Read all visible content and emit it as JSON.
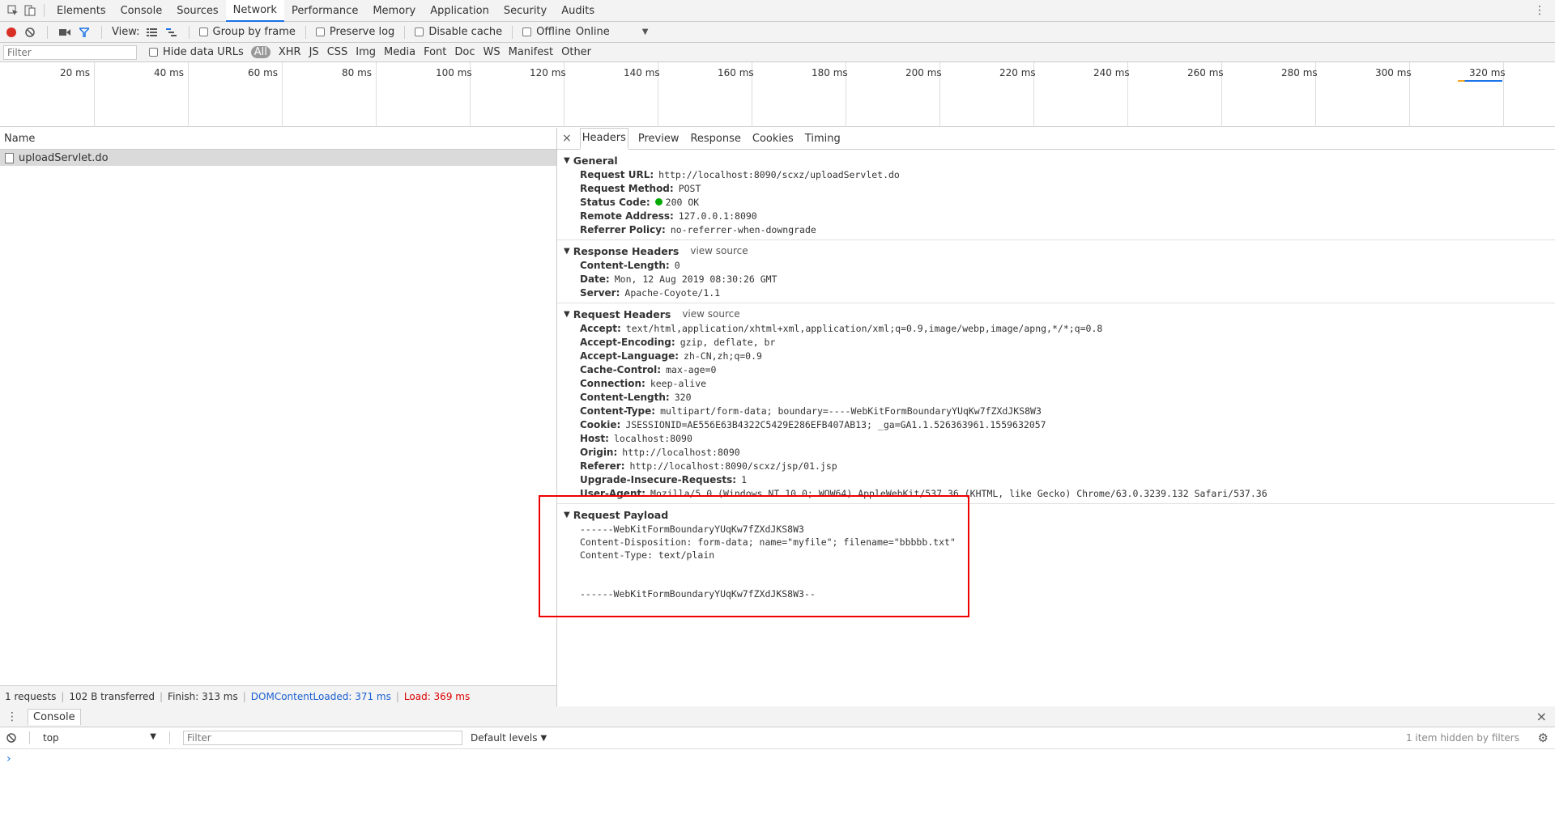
{
  "topbar": {
    "tabs": [
      "Elements",
      "Console",
      "Sources",
      "Network",
      "Performance",
      "Memory",
      "Application",
      "Security",
      "Audits"
    ],
    "active": "Network"
  },
  "toolbar": {
    "view_label": "View:",
    "group_by_frame": "Group by frame",
    "preserve_log": "Preserve log",
    "disable_cache": "Disable cache",
    "offline": "Offline",
    "throttle": "Online"
  },
  "filterbar": {
    "placeholder": "Filter",
    "hide_data_urls": "Hide data URLs",
    "types": [
      "All",
      "XHR",
      "JS",
      "CSS",
      "Img",
      "Media",
      "Font",
      "Doc",
      "WS",
      "Manifest",
      "Other"
    ]
  },
  "timeline": {
    "ticks": [
      "20 ms",
      "40 ms",
      "60 ms",
      "80 ms",
      "100 ms",
      "120 ms",
      "140 ms",
      "160 ms",
      "180 ms",
      "200 ms",
      "220 ms",
      "240 ms",
      "260 ms",
      "280 ms",
      "300 ms",
      "320 ms"
    ]
  },
  "requests": {
    "name_header": "Name",
    "items": [
      "uploadServlet.do"
    ]
  },
  "status": {
    "requests": "1 requests",
    "transferred": "102 B transferred",
    "finish": "Finish: 313 ms",
    "dcl": "DOMContentLoaded: 371 ms",
    "load": "Load: 369 ms"
  },
  "detail": {
    "tabs": [
      "Headers",
      "Preview",
      "Response",
      "Cookies",
      "Timing"
    ],
    "general": {
      "title": "General",
      "rows": [
        {
          "k": "Request URL:",
          "v": "http://localhost:8090/scxz/uploadServlet.do"
        },
        {
          "k": "Request Method:",
          "v": "POST"
        },
        {
          "k": "Status Code:",
          "v": "200 OK"
        },
        {
          "k": "Remote Address:",
          "v": "127.0.0.1:8090"
        },
        {
          "k": "Referrer Policy:",
          "v": "no-referrer-when-downgrade"
        }
      ]
    },
    "response_headers": {
      "title": "Response Headers",
      "view_source": "view source",
      "rows": [
        {
          "k": "Content-Length:",
          "v": "0"
        },
        {
          "k": "Date:",
          "v": "Mon, 12 Aug 2019 08:30:26 GMT"
        },
        {
          "k": "Server:",
          "v": "Apache-Coyote/1.1"
        }
      ]
    },
    "request_headers": {
      "title": "Request Headers",
      "view_source": "view source",
      "rows": [
        {
          "k": "Accept:",
          "v": "text/html,application/xhtml+xml,application/xml;q=0.9,image/webp,image/apng,*/*;q=0.8"
        },
        {
          "k": "Accept-Encoding:",
          "v": "gzip, deflate, br"
        },
        {
          "k": "Accept-Language:",
          "v": "zh-CN,zh;q=0.9"
        },
        {
          "k": "Cache-Control:",
          "v": "max-age=0"
        },
        {
          "k": "Connection:",
          "v": "keep-alive"
        },
        {
          "k": "Content-Length:",
          "v": "320"
        },
        {
          "k": "Content-Type:",
          "v": "multipart/form-data; boundary=----WebKitFormBoundaryYUqKw7fZXdJKS8W3"
        },
        {
          "k": "Cookie:",
          "v": "JSESSIONID=AE556E63B4322C5429E286EFB407AB13; _ga=GA1.1.526363961.1559632057"
        },
        {
          "k": "Host:",
          "v": "localhost:8090"
        },
        {
          "k": "Origin:",
          "v": "http://localhost:8090"
        },
        {
          "k": "Referer:",
          "v": "http://localhost:8090/scxz/jsp/01.jsp"
        },
        {
          "k": "Upgrade-Insecure-Requests:",
          "v": "1"
        },
        {
          "k": "User-Agent:",
          "v": "Mozilla/5.0 (Windows NT 10.0; WOW64) AppleWebKit/537.36 (KHTML, like Gecko) Chrome/63.0.3239.132 Safari/537.36"
        }
      ]
    },
    "payload": {
      "title": "Request Payload",
      "lines": [
        "------WebKitFormBoundaryYUqKw7fZXdJKS8W3",
        "Content-Disposition: form-data; name=\"myfile\"; filename=\"bbbbb.txt\"",
        "Content-Type: text/plain",
        "",
        "",
        "------WebKitFormBoundaryYUqKw7fZXdJKS8W3--"
      ]
    }
  },
  "drawer": {
    "tab": "Console",
    "context": "top",
    "filter_placeholder": "Filter",
    "levels": "Default levels",
    "hidden": "1 item hidden by filters",
    "prompt": "›"
  },
  "colors": {
    "highlight": "#e00000",
    "record": "#d93025",
    "filter_active": "#1a73e8",
    "status_ok": "#0a0",
    "dcl": "#1a5fd0",
    "load": "#d00000"
  }
}
